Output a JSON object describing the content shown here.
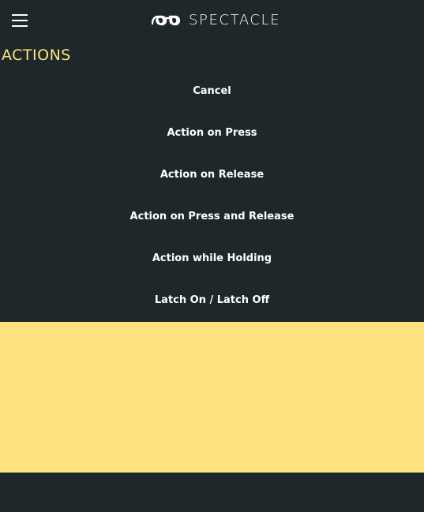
{
  "header": {
    "brand_name": "SPECTACLE",
    "menu_icon": "hamburger-icon",
    "logo_icon": "spectacles-logo-icon"
  },
  "actions": {
    "title": "ACTIONS",
    "items": [
      {
        "label": "Cancel"
      },
      {
        "label": "Action on Press"
      },
      {
        "label": "Action on Release"
      },
      {
        "label": "Action on Press and Release"
      },
      {
        "label": "Action while Holding"
      },
      {
        "label": "Latch On / Latch Off"
      }
    ]
  },
  "colors": {
    "background": "#1e282a",
    "accent": "#ffe380",
    "text": "#ffffff"
  }
}
